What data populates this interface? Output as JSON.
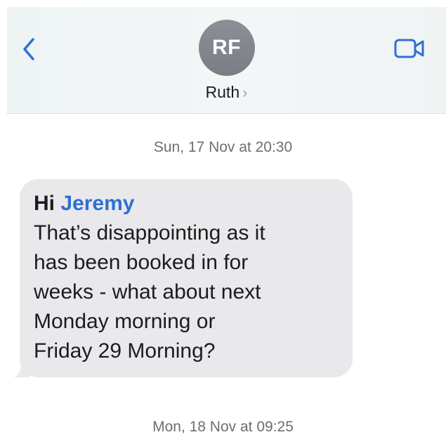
{
  "header": {
    "avatar_initials": "RF",
    "contact_name": "Ruth",
    "chevron": "›",
    "back_icon": "chevron-left-icon",
    "video_icon": "video-camera-icon",
    "accent_color": "#2f6fd6"
  },
  "conversation": {
    "timestamps": [
      "Sun, 17 Nov at 20:30",
      "Mon, 18 Nov at 09:25"
    ],
    "messages": [
      {
        "greeting": "Hi",
        "mention": "Jeremy",
        "lines": [
          "That’s disappointing as it",
          "has been booked in for",
          "weeks - what about next",
          "Monday morning or",
          "Friday 29 Morning?"
        ]
      }
    ]
  }
}
